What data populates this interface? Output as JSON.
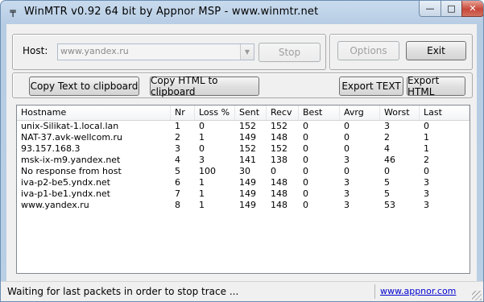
{
  "window": {
    "title": "WinMTR v0.92 64 bit by Appnor MSP - www.winmtr.net",
    "icon": "winmtr-app-icon",
    "minimize_glyph": "—",
    "maximize_glyph": "□",
    "close_glyph": "✕"
  },
  "controls": {
    "host_label": "Host:",
    "host_value": "www.yandex.ru",
    "stop_label": "Stop",
    "options_label": "Options",
    "exit_label": "Exit",
    "copy_text_label": "Copy Text to clipboard",
    "copy_html_label": "Copy HTML to clipboard",
    "export_text_label": "Export TEXT",
    "export_html_label": "Export HTML"
  },
  "table": {
    "columns": [
      "Hostname",
      "Nr",
      "Loss %",
      "Sent",
      "Recv",
      "Best",
      "Avrg",
      "Worst",
      "Last"
    ],
    "rows": [
      [
        "unix-Silikat-1.local.lan",
        "1",
        "0",
        "152",
        "152",
        "0",
        "0",
        "3",
        "0"
      ],
      [
        "NAT-37.avk-wellcom.ru",
        "2",
        "1",
        "149",
        "148",
        "0",
        "0",
        "2",
        "1"
      ],
      [
        "93.157.168.3",
        "3",
        "0",
        "152",
        "152",
        "0",
        "0",
        "4",
        "1"
      ],
      [
        "msk-ix-m9.yandex.net",
        "4",
        "3",
        "141",
        "138",
        "0",
        "3",
        "46",
        "2"
      ],
      [
        "No response from host",
        "5",
        "100",
        "30",
        "0",
        "0",
        "0",
        "0",
        "0"
      ],
      [
        "iva-p2-be5.yndx.net",
        "6",
        "1",
        "149",
        "148",
        "0",
        "3",
        "5",
        "3"
      ],
      [
        "iva-p1-be1.yndx.net",
        "7",
        "1",
        "149",
        "148",
        "0",
        "3",
        "5",
        "3"
      ],
      [
        "www.yandex.ru",
        "8",
        "1",
        "149",
        "148",
        "0",
        "3",
        "53",
        "3"
      ]
    ]
  },
  "status": {
    "text": "Waiting for last packets in order to stop trace ...",
    "link": "www.appnor.com"
  },
  "colors": {
    "link": "#0000d0",
    "close_button": "#c7473a"
  }
}
